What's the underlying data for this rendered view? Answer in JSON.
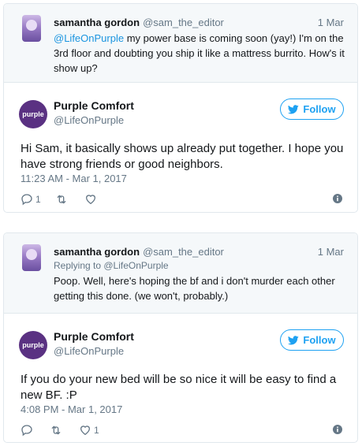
{
  "colors": {
    "accent": "#1da1f2",
    "muted": "#657786",
    "brand": "#5a3182",
    "parent_bg": "#f5f8fa"
  },
  "tweets": [
    {
      "parent": {
        "name": "samantha gordon",
        "handle": "@sam_the_editor",
        "date": "1 Mar",
        "mention": "@LifeOnPurple",
        "text": " my power base is coming soon (yay!) I'm on the 3rd floor and doubting you ship it like a mattress burrito. How's it show up?"
      },
      "reply": {
        "logo": "purple",
        "name": "Purple Comfort",
        "handle": "@LifeOnPurple",
        "follow_label": "Follow",
        "text": "Hi Sam, it basically shows up already put together. I hope you have strong friends or good neighbors.",
        "time": "11:23 AM - Mar 1, 2017",
        "reply_count": "1",
        "retweet_count": "",
        "like_count": ""
      }
    },
    {
      "parent": {
        "name": "samantha gordon",
        "handle": "@sam_the_editor",
        "date": "1 Mar",
        "replying_prefix": "Replying to ",
        "replying_to": "@LifeOnPurple",
        "text": "Poop. Well, here's hoping the bf and i don't murder each other getting this done. (we won't, probably.)"
      },
      "reply": {
        "logo": "purple",
        "name": "Purple Comfort",
        "handle": "@LifeOnPurple",
        "follow_label": "Follow",
        "text": "If you do your new bed will be so nice it will be easy to find a new BF. :P",
        "time": "4:08 PM - Mar 1, 2017",
        "reply_count": "",
        "retweet_count": "",
        "like_count": "1"
      }
    }
  ]
}
